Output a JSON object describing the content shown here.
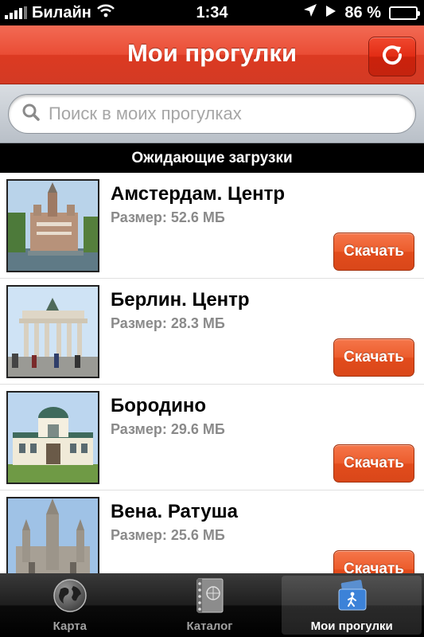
{
  "status_bar": {
    "carrier": "Билайн",
    "time": "1:34",
    "battery": "86 %",
    "battery_level": 0.86,
    "icons": [
      "signal-icon",
      "wifi-icon",
      "location-arrow-icon",
      "play-icon",
      "battery-icon"
    ]
  },
  "nav": {
    "title": "Мои прогулки",
    "refresh_icon": "refresh-icon"
  },
  "search": {
    "placeholder": "Поиск в моих прогулках",
    "value": ""
  },
  "section": {
    "title": "Ожидающие загрузки"
  },
  "walks": [
    {
      "title": "Амстердам. Центр",
      "size": "Размер: 52.6 МБ",
      "button": "Скачать",
      "thumb": "amsterdam-photo"
    },
    {
      "title": "Берлин. Центр",
      "size": "Размер: 28.3 МБ",
      "button": "Скачать",
      "thumb": "berlin-photo"
    },
    {
      "title": "Бородино",
      "size": "Размер: 29.6 МБ",
      "button": "Скачать",
      "thumb": "borodino-photo"
    },
    {
      "title": "Вена. Ратуша",
      "size": "Размер: 25.6 МБ",
      "button": "Скачать",
      "thumb": "vienna-photo"
    }
  ],
  "tabs": [
    {
      "label": "Карта",
      "icon": "globe-icon",
      "active": false
    },
    {
      "label": "Каталог",
      "icon": "catalog-book-icon",
      "active": false
    },
    {
      "label": "Мои прогулки",
      "icon": "my-walks-icon",
      "active": true
    }
  ],
  "colors": {
    "nav_red": "#e2432b",
    "download_orange": "#e8552a",
    "size_gray": "#8a8a8a"
  }
}
